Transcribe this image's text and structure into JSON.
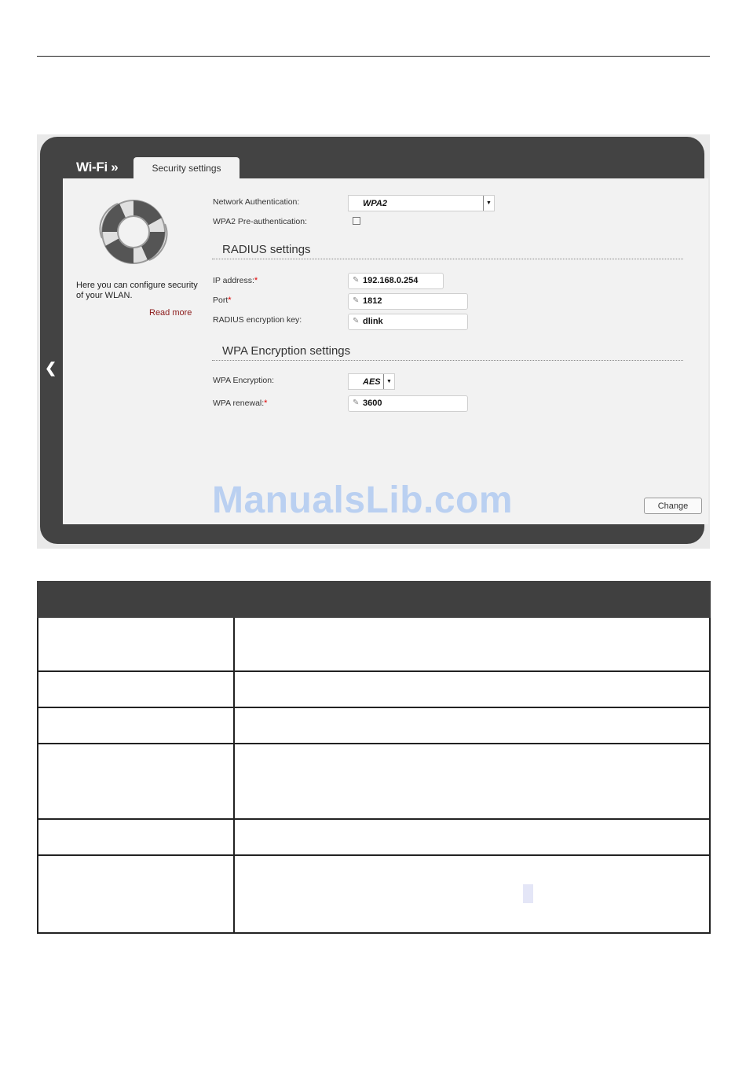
{
  "screenshot": {
    "breadcrumb": "Wi-Fi »",
    "tab": "Security settings",
    "info_text": "Here you can configure security of your WLAN.",
    "read_more": "Read more",
    "form": {
      "network_auth_label": "Network Authentication:",
      "network_auth_value": "WPA2",
      "preauth_label": "WPA2 Pre-authentication:",
      "radius_title": "RADIUS settings",
      "ip_label": "IP address:",
      "ip_value": "192.168.0.254",
      "port_label": "Port",
      "port_value": "1812",
      "radius_key_label": "RADIUS encryption key:",
      "radius_key_value": "dlink",
      "wpa_title": "WPA Encryption settings",
      "wpa_enc_label": "WPA Encryption:",
      "wpa_enc_value": "AES",
      "wpa_renewal_label": "WPA renewal:",
      "wpa_renewal_value": "3600",
      "required_mark": "*"
    },
    "change_button": "Change",
    "watermark": "ManualsLib.com"
  },
  "table": {
    "header": [
      "",
      ""
    ],
    "rows": [
      [
        "",
        ""
      ],
      [
        "",
        ""
      ],
      [
        "",
        ""
      ],
      [
        "",
        ""
      ],
      [
        "",
        ""
      ],
      [
        "",
        ""
      ]
    ]
  },
  "colors": {
    "frame": "#434343",
    "panel": "#f2f2f2",
    "table_header": "#404040",
    "link": "#8b1a1a"
  }
}
